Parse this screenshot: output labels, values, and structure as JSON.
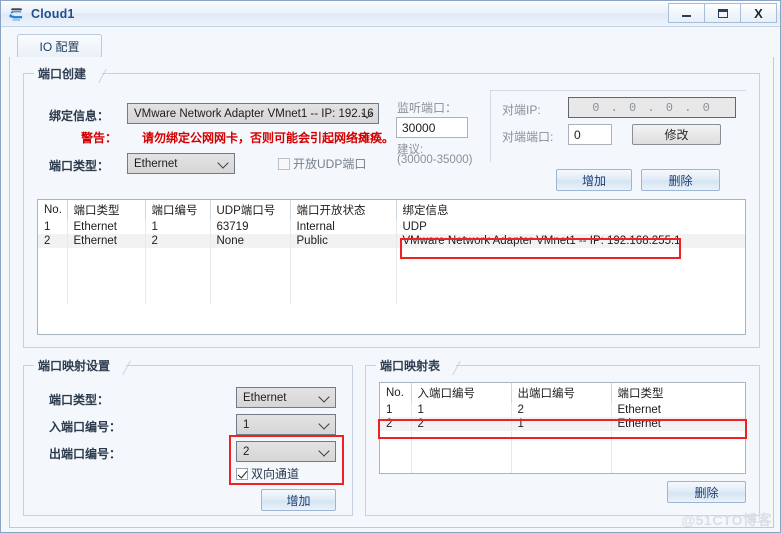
{
  "window": {
    "title": "Cloud1",
    "icon": "cloud-icon",
    "buttons": {
      "minimize": "minimize-icon",
      "maximize": "maximize-icon",
      "close": "X"
    }
  },
  "tab": {
    "label": "IO 配置"
  },
  "port_create": {
    "title": "端口创建",
    "bind_info_label": "绑定信息：",
    "bind_info_value": "VMware Network Adapter VMnet1 -- IP: 192.16",
    "warning_label": "警告：",
    "warning_text": "请勿绑定公网网卡，否则可能会引起网络瘫痪。",
    "port_type_label": "端口类型：",
    "port_type_value": "Ethernet",
    "udp_checkbox_label": "开放UDP端口",
    "listen_port_label": "监听端口：",
    "listen_port_value": "30000",
    "suggest_line1": "建议:",
    "suggest_line2": "(30000-35000)",
    "peer_ip_label": "对端IP:",
    "peer_ip_value": "0 . 0 . 0 . 0",
    "peer_port_label": "对端端口:",
    "peer_port_value": "0",
    "modify_button": "修改",
    "add_button": "增加",
    "delete_button": "删除"
  },
  "port_table": {
    "headers": [
      "No.",
      "端口类型",
      "端口编号",
      "UDP端口号",
      "端口开放状态",
      "绑定信息"
    ],
    "rows": [
      [
        "1",
        "Ethernet",
        "1",
        "63719",
        "Internal",
        "UDP"
      ],
      [
        "2",
        "Ethernet",
        "2",
        "None",
        "Public",
        "VMware Network Adapter VMnet1 -- IP: 192.168.255.1"
      ]
    ],
    "empty_rows": 4
  },
  "mapping_settings": {
    "title": "端口映射设置",
    "port_type_label": "端口类型：",
    "port_type_value": "Ethernet",
    "in_port_label": "入端口编号：",
    "in_port_value": "1",
    "out_port_label": "出端口编号：",
    "out_port_value": "2",
    "bidirectional_label": "双向通道",
    "add_button": "增加"
  },
  "mapping_table": {
    "title": "端口映射表",
    "headers": [
      "No.",
      "入端口编号",
      "出端口编号",
      "端口类型"
    ],
    "rows": [
      [
        "1",
        "1",
        "2",
        "Ethernet"
      ],
      [
        "2",
        "2",
        "1",
        "Ethernet"
      ]
    ],
    "empty_rows": 3,
    "delete_button": "删除"
  },
  "watermark": "@51CTO博客",
  "colors": {
    "accent": "#1f4e8c",
    "warning": "#d40000",
    "highlight": "#ee2222",
    "selected_row": "#f2f2f2"
  }
}
